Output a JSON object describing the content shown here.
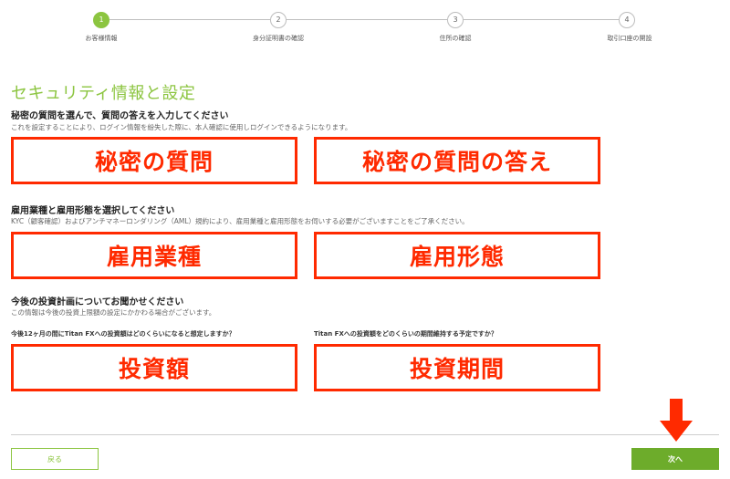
{
  "stepper": {
    "steps": [
      {
        "number": "1",
        "label": "お客様情報"
      },
      {
        "number": "2",
        "label": "身分証明書の確認"
      },
      {
        "number": "3",
        "label": "住所の確認"
      },
      {
        "number": "4",
        "label": "取引口座の開設"
      }
    ],
    "active_step": 1
  },
  "section": {
    "title": "セキュリティ情報と設定"
  },
  "security": {
    "heading": "秘密の質問を選んで、質問の答えを入力してください",
    "description": "これを設定することにより、ログイン情報を紛失した際に、本人確認に使用しログインできるようになります。",
    "question_label": "秘密の質問",
    "answer_label": "秘密の質問の答え"
  },
  "employment": {
    "heading": "雇用業種と雇用形態を選択してください",
    "description": "KYC（顧客確認）およびアンチマネーロンダリング（AML）規約により、雇用業種と雇用形態をお伺いする必要がございますことをご了承ください。",
    "industry_label": "雇用業種",
    "status_label": "雇用形態"
  },
  "investment": {
    "heading": "今後の投資計画についてお聞かせください",
    "description": "この情報は今後の投資上限額の設定にかかわる場合がございます。",
    "amount_question": "今後12ヶ月の間にTitan FXへの投資額はどのくらいになると想定しますか？",
    "period_question": "Titan FXへの投資額をどのくらいの期間維持する予定ですか？",
    "amount_label": "投資額",
    "period_label": "投資期間"
  },
  "footer": {
    "back_label": "戻る",
    "next_label": "次へ"
  },
  "colors": {
    "accent": "#8cc540",
    "highlight": "#ff2a00",
    "next_button": "#6dac2b"
  }
}
